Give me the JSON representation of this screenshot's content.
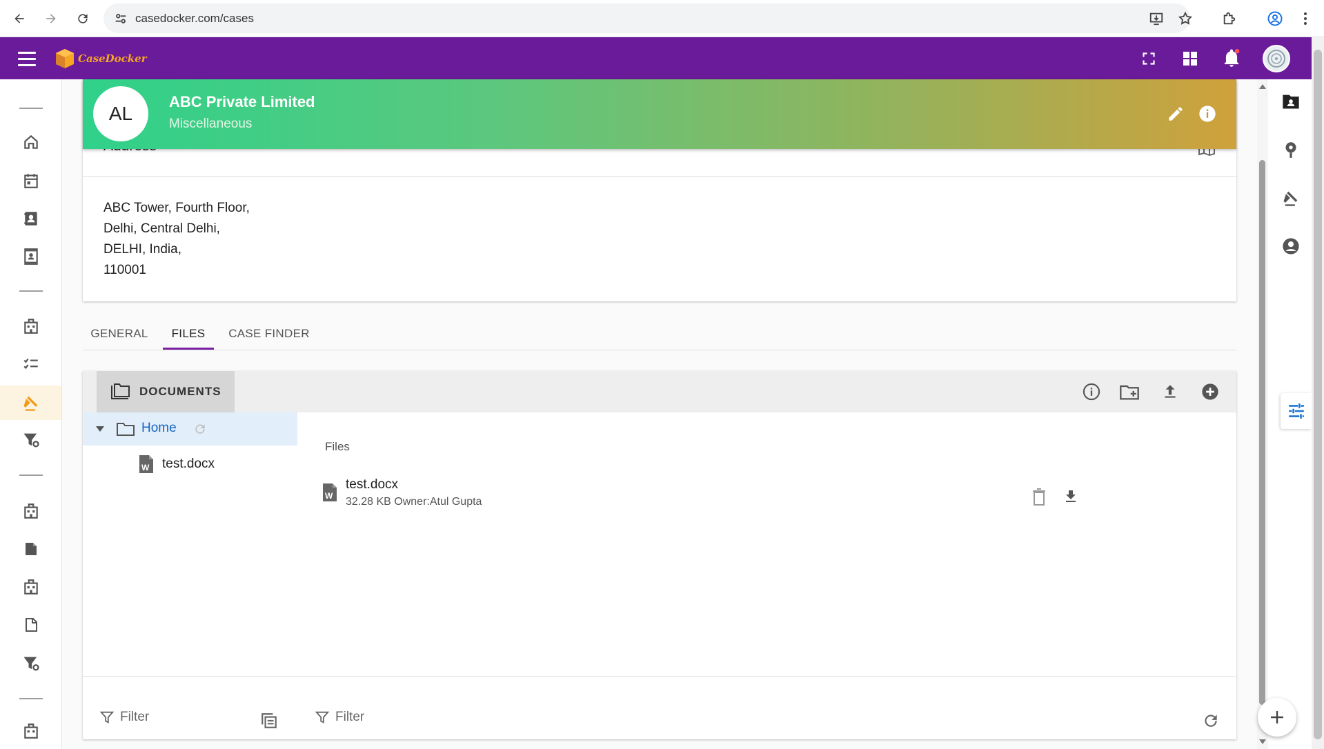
{
  "browser": {
    "url": "casedocker.com/cases"
  },
  "header": {
    "logo_text": "CaseDocker",
    "brand_color": "#6a1b9a"
  },
  "banner": {
    "initials": "AL",
    "title": "ABC Private Limited",
    "subtitle": "Miscellaneous"
  },
  "address": {
    "heading": "Address",
    "lines": [
      "ABC Tower, Fourth Floor,",
      "Delhi, Central Delhi,",
      "DELHI, India,",
      "110001"
    ]
  },
  "tabs": [
    {
      "label": "GENERAL",
      "active": false
    },
    {
      "label": "FILES",
      "active": true
    },
    {
      "label": "CASE FINDER",
      "active": false
    }
  ],
  "documents": {
    "tab_label": "DOCUMENTS",
    "tree": {
      "root_label": "Home",
      "children": [
        "test.docx"
      ]
    },
    "files_heading": "Files",
    "files": [
      {
        "name": "test.docx",
        "meta": "32.28 KB Owner:Atul Gupta"
      }
    ],
    "filter_placeholder_left": "Filter",
    "filter_placeholder_right": "Filter"
  }
}
